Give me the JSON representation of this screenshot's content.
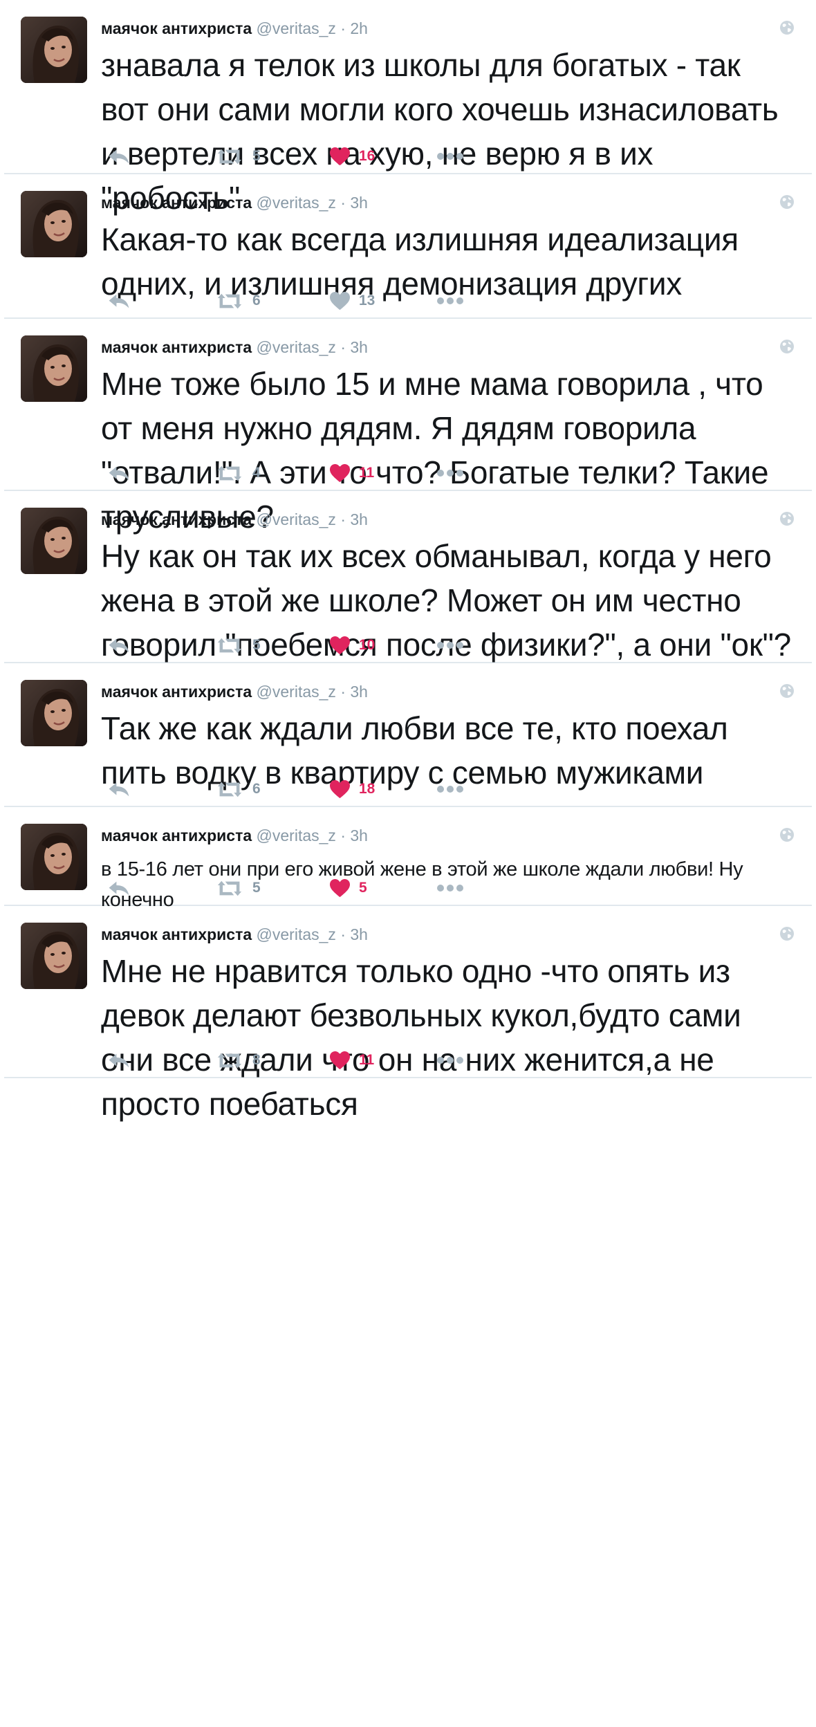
{
  "tweets": [
    {
      "name": "маячок антихриста",
      "handle": "@veritas_z",
      "separator": "·",
      "time": "2h",
      "text": "знавала я телок из школы для богатых - так вот они сами могли кого хочешь изнасиловать и вертели всех на хую, не верю я в их \"робость\"",
      "retweets": "5",
      "likes": "16",
      "liked": true
    },
    {
      "name": "маячок антихриста",
      "handle": "@veritas_z",
      "separator": "·",
      "time": "3h",
      "text": "Какая-то как всегда излишняя идеализация одних, и излишняя демонизация других",
      "retweets": "6",
      "likes": "13",
      "liked": false
    },
    {
      "name": "маячок антихриста",
      "handle": "@veritas_z",
      "separator": "·",
      "time": "3h",
      "text": "Мне тоже было 15 и мне мама говорила , что от меня нужно дядям. Я дядям говорила \"отвали!\". А эти то что? Богатые телки? Такие трусливые?",
      "retweets": "4",
      "likes": "11",
      "liked": true
    },
    {
      "name": "маячок антихриста",
      "handle": "@veritas_z",
      "separator": "·",
      "time": "3h",
      "text": "Ну как он так их всех обманывал, когда у него жена в этой же школе? Может он им честно говорил \"поебемся после физики?\", а они \"ок\"?",
      "retweets": "5",
      "likes": "10",
      "liked": true
    },
    {
      "name": "маячок антихриста",
      "handle": "@veritas_z",
      "separator": "·",
      "time": "3h",
      "text": "Так же как ждали любви все те, кто поехал пить водку в квартиру с семью мужиками",
      "retweets": "6",
      "likes": "18",
      "liked": true
    },
    {
      "name": "маячок антихриста",
      "handle": "@veritas_z",
      "separator": "·",
      "time": "3h",
      "text": "в 15-16 лет они при его живой жене в этой же школе ждали любви! Ну конечно",
      "retweets": "5",
      "likes": "5",
      "liked": true
    },
    {
      "name": "маячок антихриста",
      "handle": "@veritas_z",
      "separator": "·",
      "time": "3h",
      "text": "Мне не нравится только одно -что опять из девок делают безвольных кукол,будто сами они все ждали что он на них женится,а не просто поебаться",
      "retweets": "8",
      "likes": "11",
      "liked": true
    }
  ],
  "icons": {
    "reply": "reply-icon",
    "retweet": "retweet-icon",
    "like": "heart-icon",
    "more": "more-dots-icon",
    "globe": "globe-icon"
  },
  "colors": {
    "like_active": "#e0245e",
    "icon_gray": "#aab8c2",
    "secondary_text": "#8899a6"
  }
}
